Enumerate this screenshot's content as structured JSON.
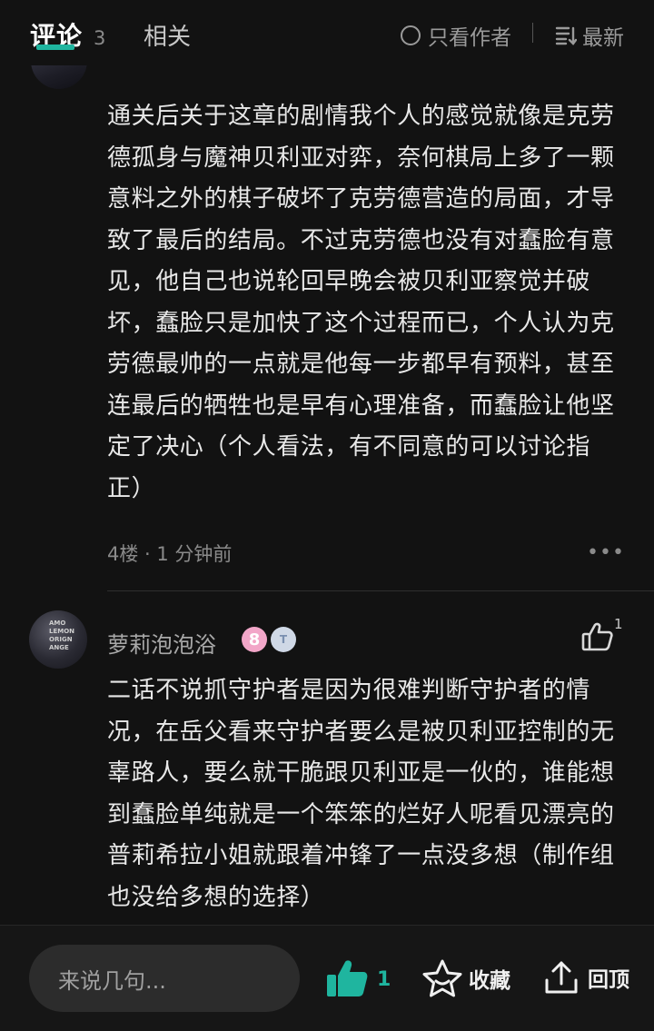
{
  "tabs": {
    "comments_label": "评论",
    "comments_count": "3",
    "related_label": "相关"
  },
  "filters": {
    "author_only_label": "只看作者",
    "sort_label": "最新"
  },
  "comments": [
    {
      "body": "通关后关于这章的剧情我个人的感觉就像是克劳德孤身与魔神贝利亚对弈，奈何棋局上多了一颗意料之外的棋子破坏了克劳德营造的局面，才导致了最后的结局。不过克劳德也没有对蠢脸有意见，他自己也说轮回早晚会被贝利亚察觉并破坏，蠢脸只是加快了这个过程而已，个人认为克劳德最帅的一点就是他每一步都早有预料，甚至连最后的牺牲也是早有心理准备，而蠢脸让他坚定了决心（个人看法，有不同意的可以讨论指正）",
      "meta": "4楼 · 1 分钟前",
      "more": "•••"
    },
    {
      "username": "萝莉泡泡浴",
      "level_badge": "8",
      "medal_badge": "T",
      "avatar_text": "AMO\nLEMON\nORIGN\nANGE",
      "like_count": "1",
      "body": "二话不说抓守护者是因为很难判断守护者的情况，在岳父看来守护者要么是被贝利亚控制的无辜路人，要么就干脆跟贝利亚是一伙的，谁能想到蠢脸单纯就是一个笨笨的烂好人呢看见漂亮的普莉希拉小姐就跟着冲锋了一点没多想（制作组也没给多想的选择）"
    }
  ],
  "bottom_bar": {
    "input_placeholder": "来说几句...",
    "like_count": "1",
    "favorite_label": "收藏",
    "back_to_top_label": "回顶"
  },
  "colors": {
    "accent": "#1fb59f",
    "background": "#121212"
  },
  "icons": [
    "radio-circle-icon",
    "sort-lines-icon",
    "more-dots-icon",
    "thumbs-up-icon",
    "star-icon",
    "arrow-up-icon"
  ]
}
